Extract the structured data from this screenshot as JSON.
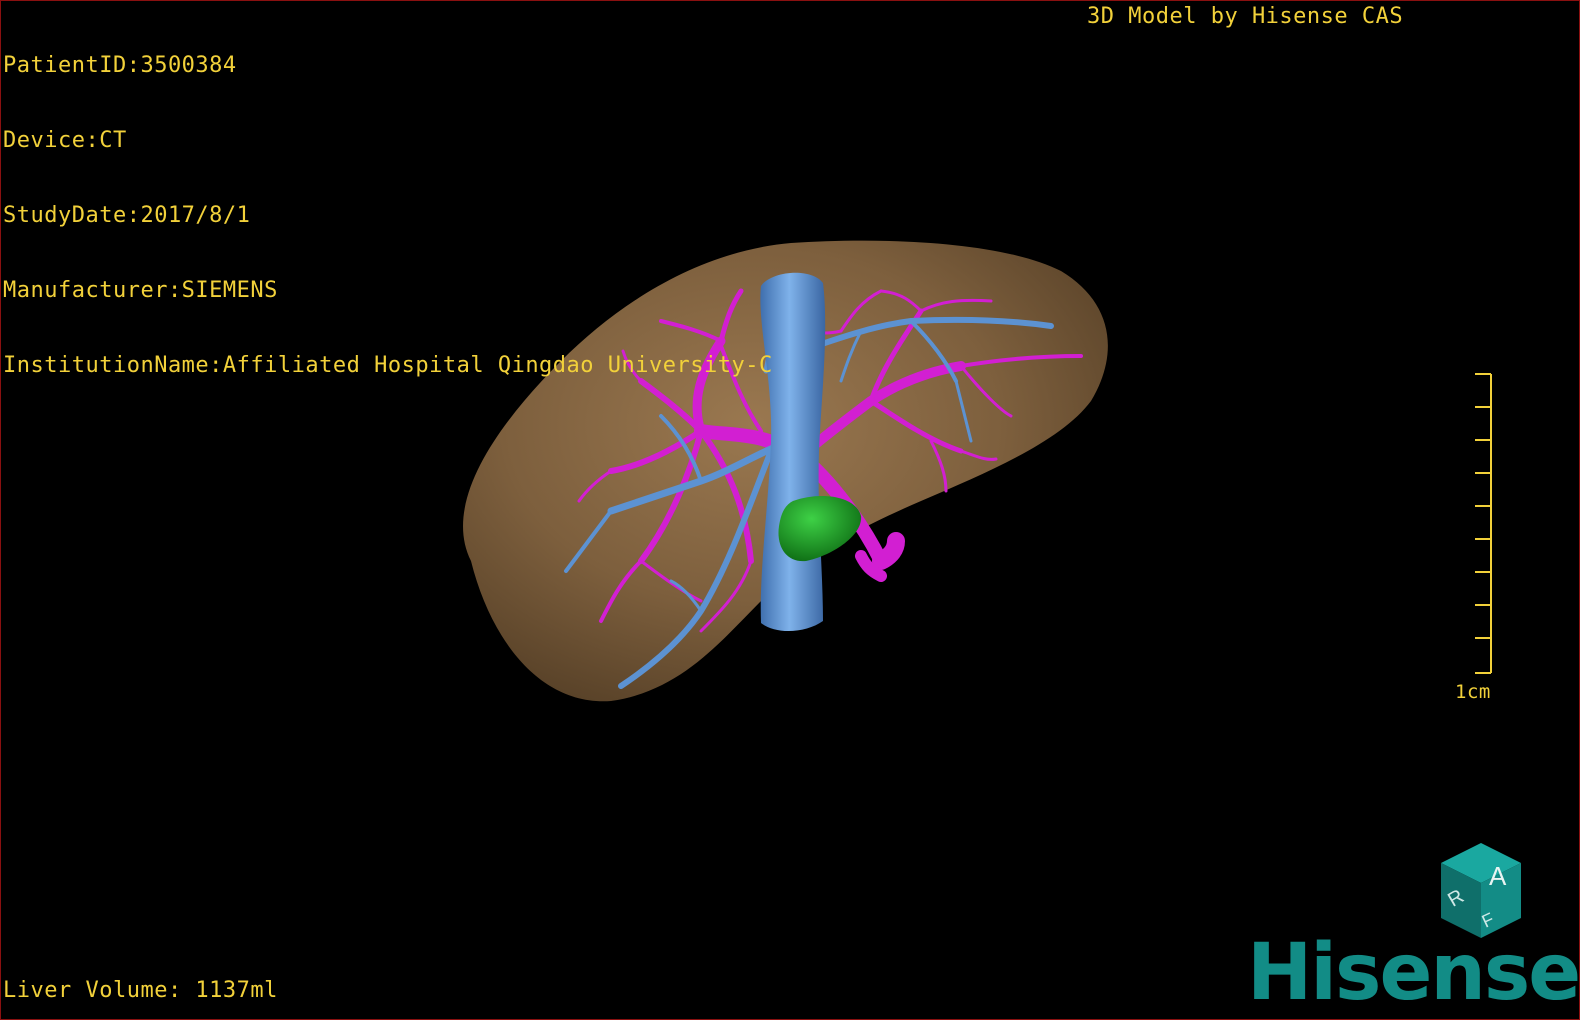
{
  "overlay": {
    "patient_id": "PatientID:3500384",
    "device": "Device:CT",
    "study_date": "StudyDate:2017/8/1",
    "manufacturer": "Manufacturer:SIEMENS",
    "institution": "InstitutionName:Affiliated Hospital Qingdao University-C",
    "credit": "3D Model by Hisense CAS",
    "liver_volume": "Liver Volume: 1137ml"
  },
  "scale_bar": {
    "label": "1cm",
    "color": "#f2d13a"
  },
  "orientation_cube": {
    "face_top": "A",
    "face_left": "R",
    "face_front": "F",
    "color": "#12928c"
  },
  "logo": {
    "text": "Hisense",
    "color": "#128c86"
  },
  "model_colors": {
    "liver": "#8a6a45",
    "portal_vein": "#d21fd2",
    "hepatic_vein": "#5c92d2",
    "lesion": "#1fa326"
  },
  "icons": [
    "orientation-cube-icon",
    "scale-bar-icon",
    "hisense-logo-icon"
  ]
}
